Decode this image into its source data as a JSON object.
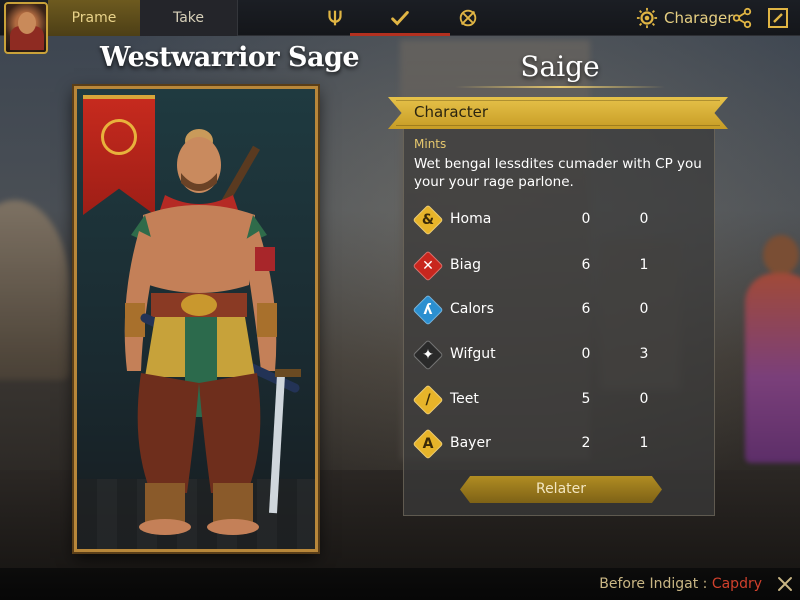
{
  "tabs": [
    {
      "label": "Prame",
      "active": true
    },
    {
      "label": "Take",
      "active": false
    }
  ],
  "toolbar": {
    "icons": [
      "trident-icon",
      "check-icon",
      "swords-emblem-icon"
    ],
    "active_icon": "check-icon",
    "user_label": "Charager",
    "user_icon": "sun-gear-icon",
    "share_icon": "share-icon",
    "edit_icon": "edit-icon"
  },
  "hero": {
    "name": "Westwarrior Sage"
  },
  "class_title": "Saige",
  "panel": {
    "header": "Character",
    "subheading": "Mints",
    "description": "Wet bengal lessdites cumader with CP you your your rage parlone.",
    "stats": [
      {
        "name": "Homa",
        "icon": "ampersand-diamond-icon",
        "color": "#e7b42a",
        "glyph": "&",
        "v1": "0",
        "v2": "0"
      },
      {
        "name": "Biag",
        "icon": "cross-diamond-icon",
        "color": "#c8261e",
        "glyph": "✕",
        "v1": "6",
        "v2": "1"
      },
      {
        "name": "Calors",
        "icon": "rune-diamond-icon",
        "color": "#2b8fd0",
        "glyph": "ʎ",
        "v1": "6",
        "v2": "0"
      },
      {
        "name": "Wifgut",
        "icon": "dark-diamond-icon",
        "color": "#2a2a2a",
        "glyph": "✦",
        "v1": "0",
        "v2": "3"
      },
      {
        "name": "Teet",
        "icon": "slash-diamond-icon",
        "color": "#e7b42a",
        "glyph": "/",
        "v1": "5",
        "v2": "0"
      },
      {
        "name": "Bayer",
        "icon": "a-diamond-icon",
        "color": "#e7b42a",
        "glyph": "A",
        "v1": "2",
        "v2": "1"
      }
    ],
    "button_label": "Relater"
  },
  "footer": {
    "text": "Before Indigat : ",
    "accent": "Capdry",
    "accent_color": "#d0402c"
  },
  "colors": {
    "gold": "#c9a23a",
    "header_gold": "#e6c24a",
    "active_red": "#b3301f"
  }
}
